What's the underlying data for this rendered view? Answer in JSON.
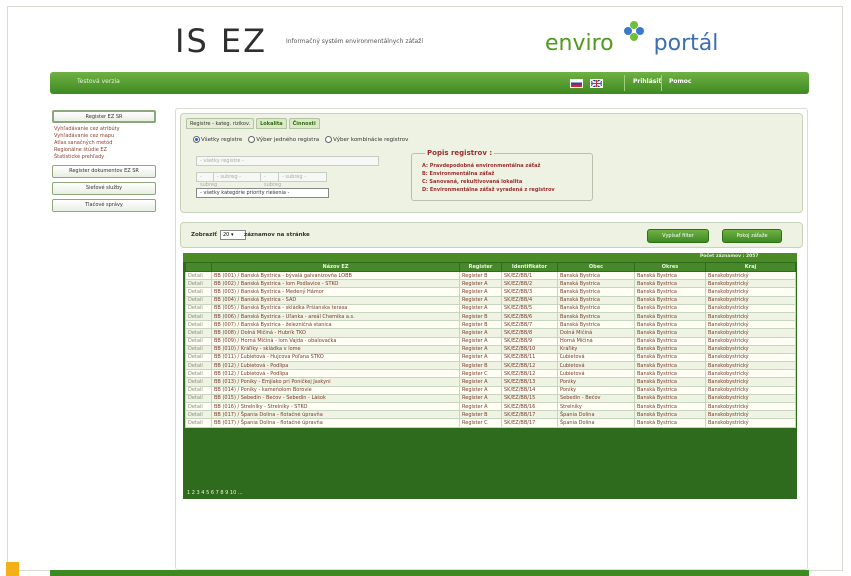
{
  "header": {
    "logo": "IS EZ",
    "tagline": "Informačný systém environmentálnych záťaží",
    "portal_a": "enviro",
    "portal_b": "portál"
  },
  "topbar": {
    "title": "Testová verzia",
    "login": "Prihlásiť",
    "help": "Pomoc"
  },
  "sidebar": {
    "register_button": "Register EZ SR",
    "links": [
      "Vyhľadávanie cez atribúty",
      "Vyhľadávanie cez mapu",
      "Atlas sanačných metód",
      "Regionálne štúdie EZ",
      "Štatistické prehľady"
    ],
    "docs_button": "Register dokumentov EZ SR",
    "services_button": "Sieťové služby",
    "press_button": "Tlačové správy"
  },
  "filter": {
    "tabs": [
      "Registre - kateg. rizikov.",
      "Lokalita",
      "Činnosti"
    ],
    "radios": [
      "Všetky registre",
      "Výber jedného registra",
      "Výber kombinácie registrov"
    ],
    "sel1": "- všetky registre -",
    "sel2a": "- subreg -",
    "sel2b": "- subreg -",
    "sel2c": "- subreg -",
    "sel2d": "- subreg -",
    "sel3": "- všetky kategórie priority riešenia -",
    "popis_title": "Popis registrov :",
    "popis": [
      "A: Pravdepodobná environmentálna záťaž",
      "B: Environmentálna záťaž",
      "C: Sanovaná, rekultivovaná lokalita",
      "D: Environmentálna záťaž vyradená z registrov"
    ]
  },
  "list": {
    "show_label": "Zobraziť",
    "per_page": "20",
    "per_page_after": "záznamov na stránke",
    "print_button": "Vypísať filter",
    "reset_button": "Pokoj záťaže",
    "count": "Počet záznamov : 2057",
    "columns": [
      "",
      "Názov EZ",
      "Register",
      "Identifikátor",
      "Obec",
      "Okres",
      "Kraj"
    ],
    "rows": [
      [
        "Detail",
        "BB (001) / Banská Bystrica - bývalá galvanizovňa LOBB",
        "Register B",
        "SK/EZ/BB/1",
        "Banská Bystrica",
        "Banská Bystrica",
        "Banskobystrický"
      ],
      [
        "Detail",
        "BB (002) / Banská Bystrica - lom Podlavice - STKO",
        "Register A",
        "SK/EZ/BB/2",
        "Banská Bystrica",
        "Banská Bystrica",
        "Banskobystrický"
      ],
      [
        "Detail",
        "BB (003) / Banská Bystrica - Medený Hámor",
        "Register A",
        "SK/EZ/BB/3",
        "Banská Bystrica",
        "Banská Bystrica",
        "Banskobystrický"
      ],
      [
        "Detail",
        "BB (004) / Banská Bystrica - SAD",
        "Register A",
        "SK/EZ/BB/4",
        "Banská Bystrica",
        "Banská Bystrica",
        "Banskobystrický"
      ],
      [
        "Detail",
        "BB (005) / Banská Bystrica - skládka Pršianska terasa",
        "Register A",
        "SK/EZ/BB/5",
        "Banská Bystrica",
        "Banská Bystrica",
        "Banskobystrický"
      ],
      [
        "Detail",
        "BB (006) / Banská Bystrica - Uľanka - areál Chemika a.s.",
        "Register B",
        "SK/EZ/BB/6",
        "Banská Bystrica",
        "Banská Bystrica",
        "Banskobystrický"
      ],
      [
        "Detail",
        "BB (007) / Banská Bystrica - železničná stanica",
        "Register B",
        "SK/EZ/BB/7",
        "Banská Bystrica",
        "Banská Bystrica",
        "Banskobystrický"
      ],
      [
        "Detail",
        "BB (008) / Dolná Mičiná - Hubrík TKO",
        "Register A",
        "SK/EZ/BB/8",
        "Dolná Mičiná",
        "Banská Bystrica",
        "Banskobystrický"
      ],
      [
        "Detail",
        "BB (009) / Horná Mičiná - lom Vajda - obalovačka",
        "Register A",
        "SK/EZ/BB/9",
        "Horná Mičiná",
        "Banská Bystrica",
        "Banskobystrický"
      ],
      [
        "Detail",
        "BB (010) / Kráľiky - skládka v lome",
        "Register A",
        "SK/EZ/BB/10",
        "Kráľiky",
        "Banská Bystrica",
        "Banskobystrický"
      ],
      [
        "Detail",
        "BB (011) / Ľubietová - Hujcova Poľana STKO",
        "Register A",
        "SK/EZ/BB/11",
        "Ľubietová",
        "Banská Bystrica",
        "Banskobystrický"
      ],
      [
        "Detail",
        "BB (012) / Ľubietová - Podlipa",
        "Register B",
        "SK/EZ/BB/12",
        "Ľubietová",
        "Banská Bystrica",
        "Banskobystrický"
      ],
      [
        "Detail",
        "BB (012) / Ľubietová - Podlipa",
        "Register C",
        "SK/EZ/BB/12",
        "Ľubietová",
        "Banská Bystrica",
        "Banskobystrický"
      ],
      [
        "Detail",
        "BB (013) / Poniky - Emjíako pri Poničkej Jaskyni",
        "Register A",
        "SK/EZ/BB/13",
        "Poniky",
        "Banská Bystrica",
        "Banskobystrický"
      ],
      [
        "Detail",
        "BB (014) / Poniky - kameňolom Bórovie",
        "Register A",
        "SK/EZ/BB/14",
        "Poniky",
        "Banská Bystrica",
        "Banskobystrický"
      ],
      [
        "Detail",
        "BB (015) / Sebedín - Bečov - Sebedín - Lášok",
        "Register A",
        "SK/EZ/BB/15",
        "Sebedín - Bečov",
        "Banská Bystrica",
        "Banskobystrický"
      ],
      [
        "Detail",
        "BB (016) / Strelníky - Strelníky - STKO",
        "Register A",
        "SK/EZ/BB/16",
        "Strelníky",
        "Banská Bystrica",
        "Banskobystrický"
      ],
      [
        "Detail",
        "BB (017) / Špania Dolina - flotačné úpravňa",
        "Register B",
        "SK/EZ/BB/17",
        "Špania Dolina",
        "Banská Bystrica",
        "Banskobystrický"
      ],
      [
        "Detail",
        "BB (017) / Špania Dolina - flotačné úpravňa",
        "Register C",
        "SK/EZ/BB/17",
        "Špania Dolina",
        "Banská Bystrica",
        "Banskobystrický"
      ]
    ],
    "pager": "1 2 3 4 5 6 7 8 9 10 ..."
  },
  "colors": {
    "accent": "#4b8a24",
    "text_link": "#8a3f2f"
  }
}
